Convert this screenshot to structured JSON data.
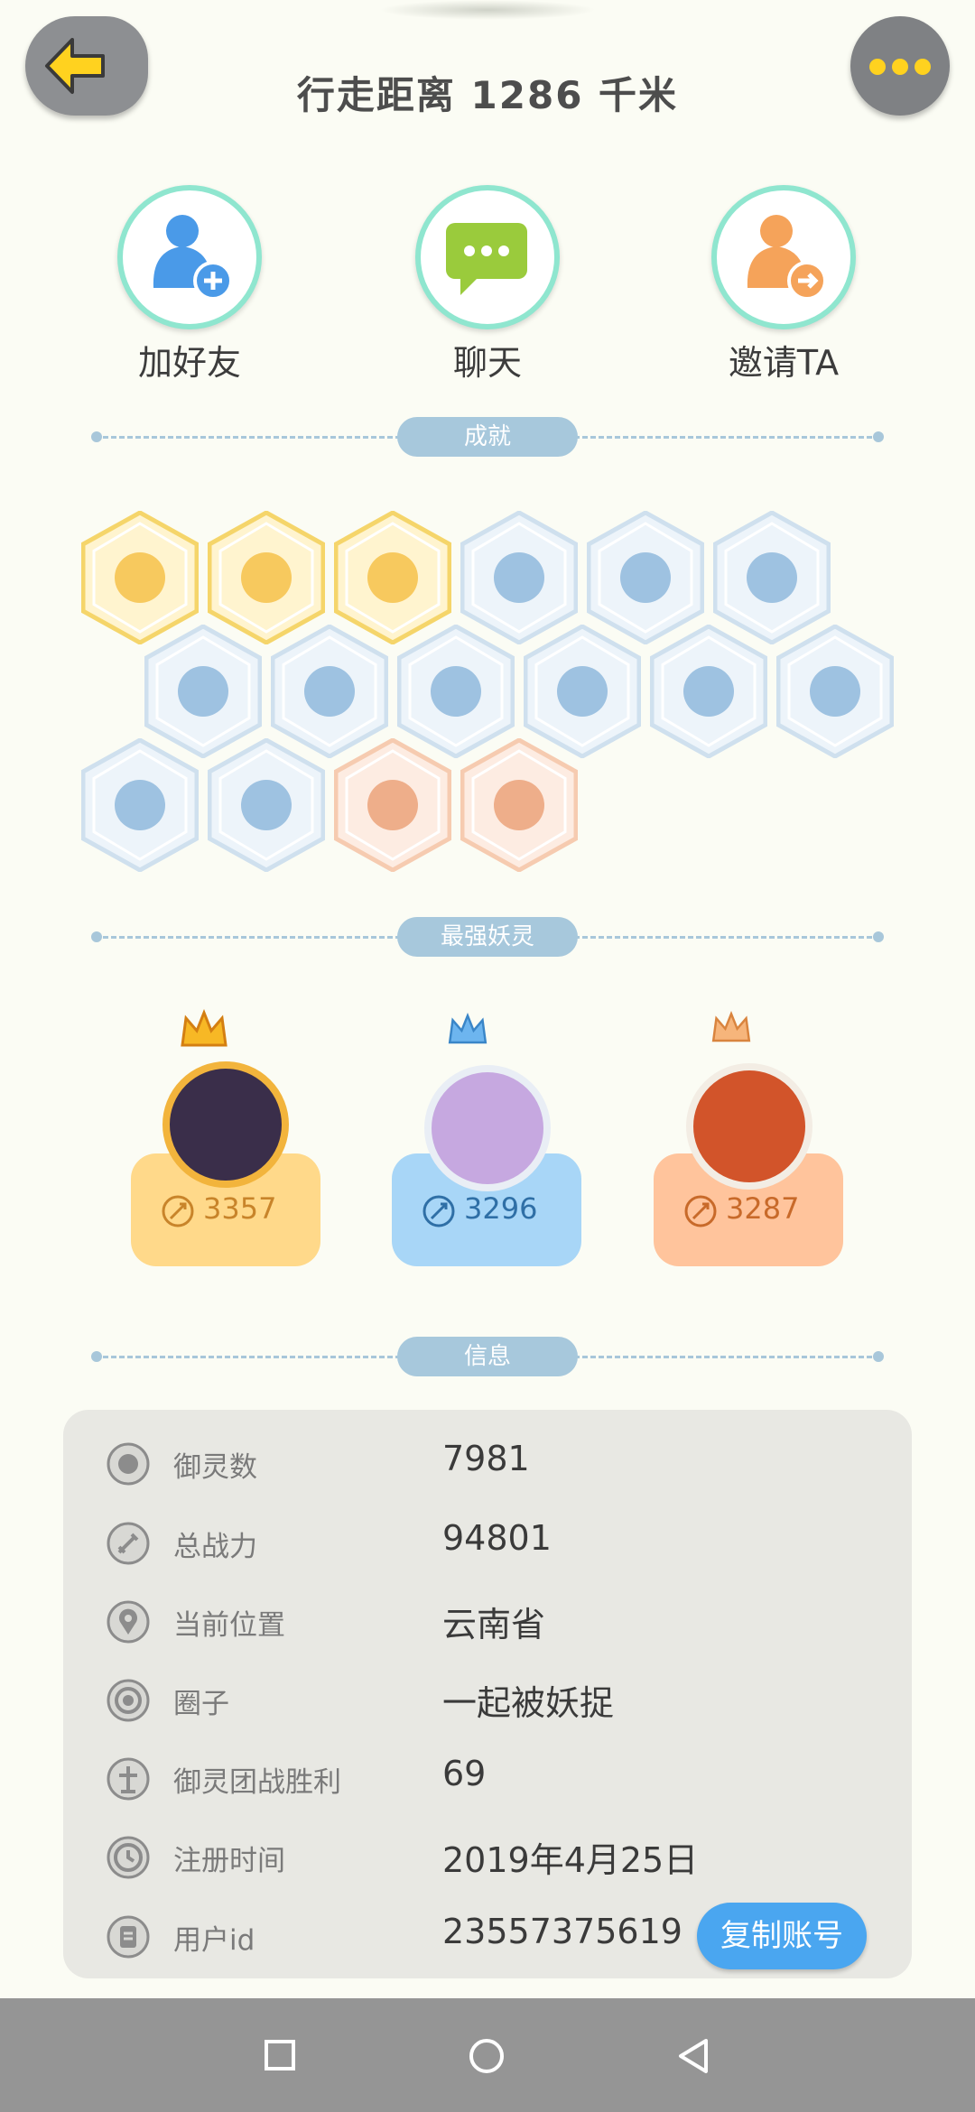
{
  "header": {
    "title": "行走距离 1286 千米"
  },
  "actions": [
    {
      "label": "加好友",
      "icon": "add-friend-icon"
    },
    {
      "label": "聊天",
      "icon": "chat-icon"
    },
    {
      "label": "邀请TA",
      "icon": "invite-icon"
    }
  ],
  "sections": {
    "achievements": "成就",
    "strongest": "最强妖灵",
    "info": "信息"
  },
  "strongest": [
    {
      "score": "3357",
      "color": "#ffd98a",
      "text_color": "#c8842a"
    },
    {
      "score": "3296",
      "color": "#a8d6f7",
      "text_color": "#2f6fa6"
    },
    {
      "score": "3287",
      "color": "#ffc49c",
      "text_color": "#c86a2a"
    }
  ],
  "info": {
    "rows": [
      {
        "label": "御灵数",
        "value": "7981"
      },
      {
        "label": "总战力",
        "value": "94801"
      },
      {
        "label": "当前位置",
        "value": "云南省"
      },
      {
        "label": "圈子",
        "value": "一起被妖捉"
      },
      {
        "label": "御灵团战胜利",
        "value": "69"
      },
      {
        "label": "注册时间",
        "value": "2019年4月25日"
      },
      {
        "label": "用户id",
        "value": "23557375619"
      }
    ],
    "copy_button": "复制账号"
  },
  "colors": {
    "accent_yellow": "#ffd21f",
    "divider_blue": "#a7c8dc",
    "copy_blue": "#4aa6f0"
  }
}
